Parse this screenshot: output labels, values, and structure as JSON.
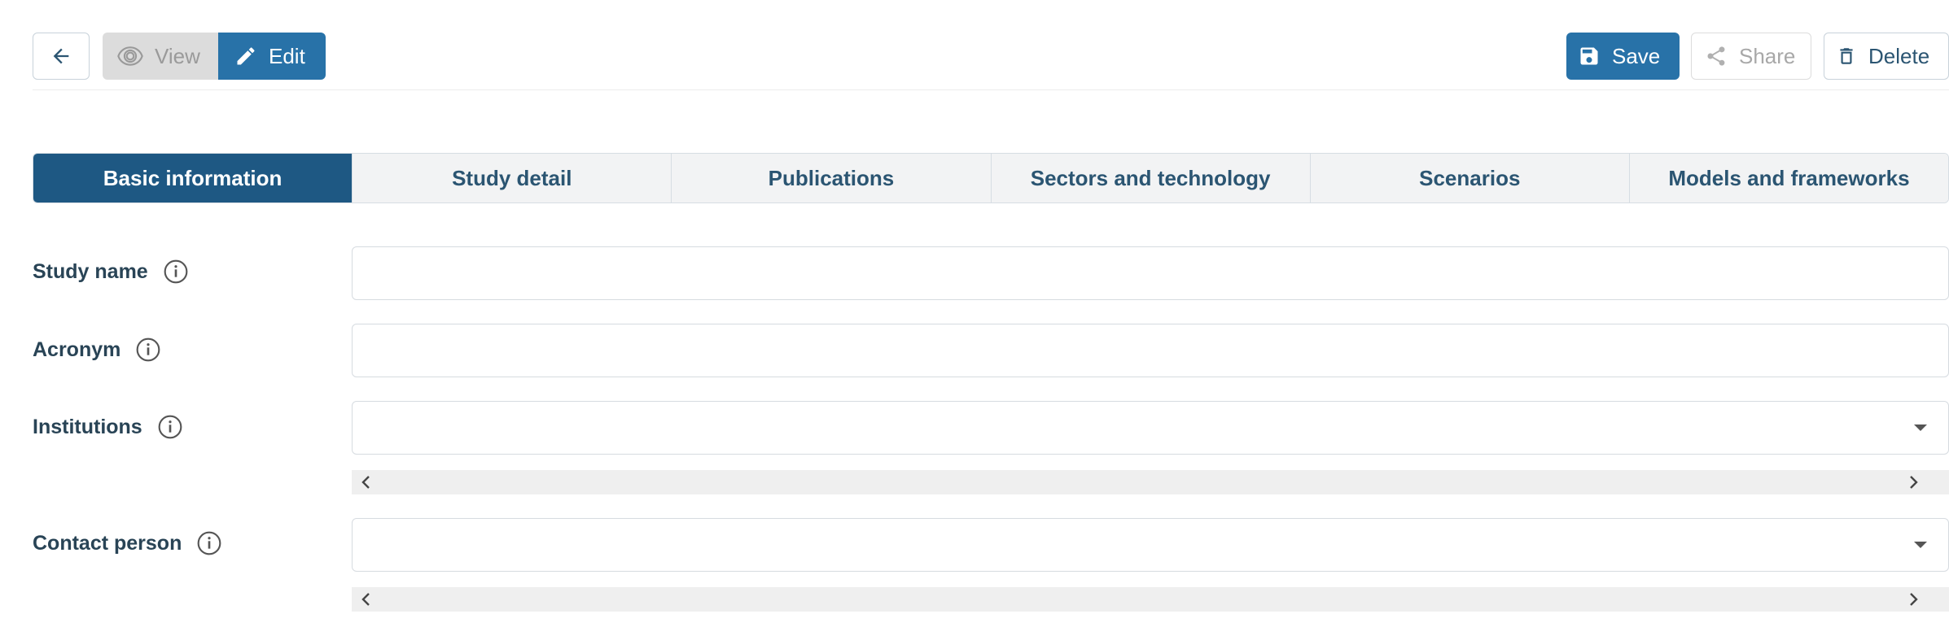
{
  "toolbar": {
    "back_icon": "arrow-left-icon",
    "view_label": "View",
    "edit_label": "Edit",
    "save_label": "Save",
    "share_label": "Share",
    "delete_label": "Delete"
  },
  "tabs": [
    {
      "label": "Basic information",
      "active": true
    },
    {
      "label": "Study detail",
      "active": false
    },
    {
      "label": "Publications",
      "active": false
    },
    {
      "label": "Sectors and technology",
      "active": false
    },
    {
      "label": "Scenarios",
      "active": false
    },
    {
      "label": "Models and frameworks",
      "active": false
    }
  ],
  "form": {
    "study_name": {
      "label": "Study name",
      "value": ""
    },
    "acronym": {
      "label": "Acronym",
      "value": ""
    },
    "institutions": {
      "label": "Institutions",
      "value": ""
    },
    "contact_person": {
      "label": "Contact person",
      "value": ""
    }
  },
  "colors": {
    "primary": "#2872a8",
    "tab_active": "#1e5883",
    "label_text": "#294456"
  }
}
